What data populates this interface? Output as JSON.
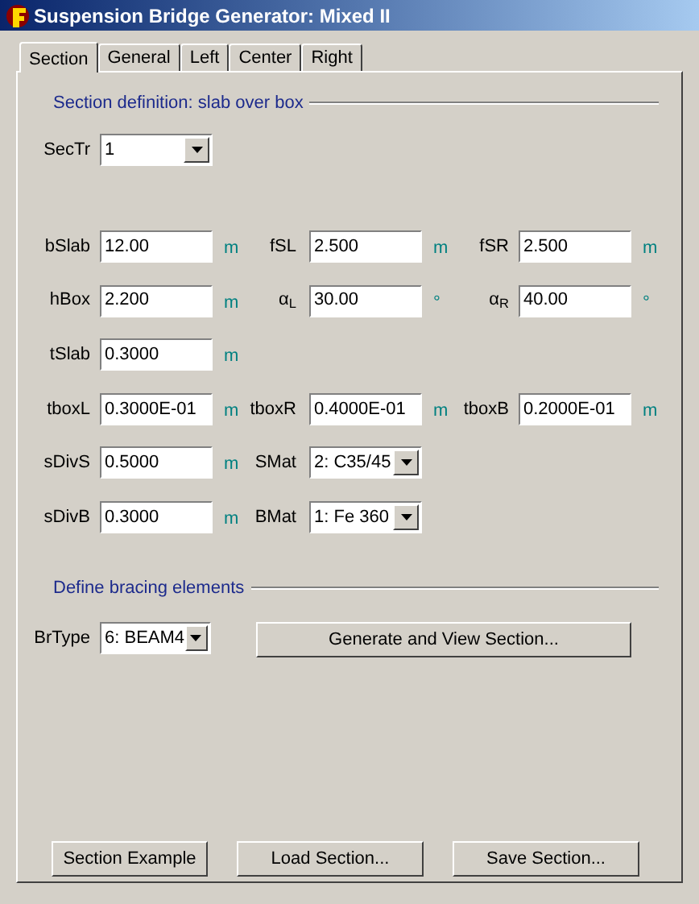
{
  "window": {
    "title": "Suspension Bridge Generator: Mixed II"
  },
  "tabs": [
    {
      "label": "Section",
      "selected": true
    },
    {
      "label": "General",
      "selected": false
    },
    {
      "label": "Left",
      "selected": false
    },
    {
      "label": "Center",
      "selected": false
    },
    {
      "label": "Right",
      "selected": false
    }
  ],
  "section_definition": {
    "heading": "Section definition: slab over box",
    "type_field": {
      "label": "SecTr",
      "value": "1"
    },
    "rows": [
      [
        {
          "kind": "text",
          "label": "bSlab",
          "value": "12.00",
          "unit": "m"
        },
        {
          "kind": "text",
          "label": "fSL",
          "value": "2.500",
          "unit": "m"
        },
        {
          "kind": "text",
          "label": "fSR",
          "value": "2.500",
          "unit": "m"
        }
      ],
      [
        {
          "kind": "text",
          "label": "hBox",
          "value": "2.200",
          "unit": "m"
        },
        {
          "kind": "text",
          "label": "α$_{L}$",
          "value": "30.00",
          "unit": "°"
        },
        {
          "kind": "text",
          "label": "α$_{R}$",
          "value": "40.00",
          "unit": "°"
        }
      ],
      [
        {
          "kind": "text",
          "label": "tSlab",
          "value": "0.3000",
          "unit": "m"
        }
      ],
      [
        {
          "kind": "text",
          "label": "tboxL",
          "value": "0.3000E-01",
          "unit": "m"
        },
        {
          "kind": "text",
          "label": "tboxR",
          "value": "0.4000E-01",
          "unit": "m"
        },
        {
          "kind": "text",
          "label": "tboxB",
          "value": "0.2000E-01",
          "unit": "m"
        }
      ],
      [
        {
          "kind": "text",
          "label": "sDivS",
          "value": "0.5000",
          "unit": "m"
        },
        {
          "kind": "select",
          "label": "SMat",
          "value": "2: C35/45"
        }
      ],
      [
        {
          "kind": "text",
          "label": "sDivB",
          "value": "0.3000",
          "unit": "m"
        },
        {
          "kind": "select",
          "label": "BMat",
          "value": "1: Fe 360"
        }
      ]
    ]
  },
  "bracing": {
    "heading": "Define bracing elements",
    "type_field": {
      "label": "BrType",
      "value": "6: BEAM4"
    },
    "button": "Generate and View Section..."
  },
  "buttons": [
    "Section Example",
    "Load Section...",
    "Save Section..."
  ]
}
